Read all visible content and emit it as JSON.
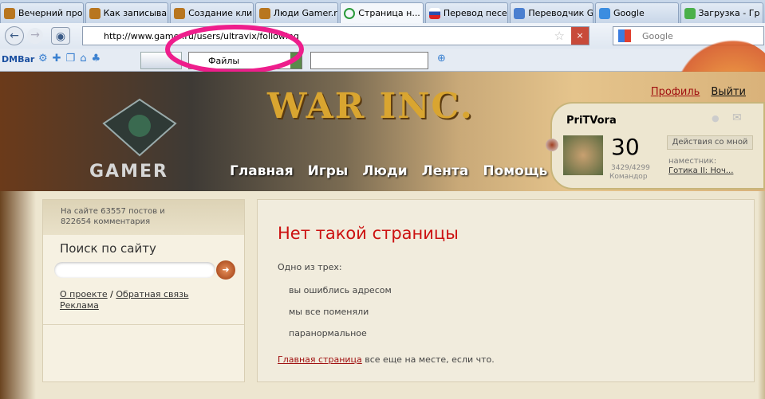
{
  "tabs": [
    "Вечерний про...",
    "Как записыва...",
    "Создание кли...",
    "Люди Gamer.ru...",
    "Страница н...",
    "Перевод песе...",
    "Переводчик G...",
    "Google",
    "Загрузка - Гр"
  ],
  "url": "http://www.gamer.ru/users/ultravix/following",
  "search_placeholder": "Google",
  "toolbar": {
    "dmbar": "DMBar",
    "files": "Файлы"
  },
  "site": {
    "title": "WAR INC.",
    "logo": "GAMER",
    "menu": [
      "Главная",
      "Игры",
      "Люди",
      "Лента",
      "Помощь"
    ],
    "profile": "Профиль",
    "logout": "Выйти"
  },
  "user": {
    "name": "PriTVora",
    "level": "30",
    "xp": "3429/4299",
    "rank": "Командор",
    "actions": "Действия со мной",
    "deputy_label": "наместник:",
    "deputy": "Готика II: Ноч..."
  },
  "sidebar": {
    "stats_line1": "На сайте 63557 постов и",
    "stats_line2": "822654 комментария",
    "search_title": "Поиск по сайту",
    "about": "О проекте",
    "sep": "/",
    "feedback": "Обратная связь",
    "ads": "Реклама"
  },
  "main": {
    "title": "Нет такой страницы",
    "intro": "Одно из трех:",
    "reasons": [
      "вы ошиблись адресом",
      "мы все поменяли",
      "паранормальное"
    ],
    "home_link": "Главная страница",
    "home_rest": " все еще на месте, если что."
  }
}
